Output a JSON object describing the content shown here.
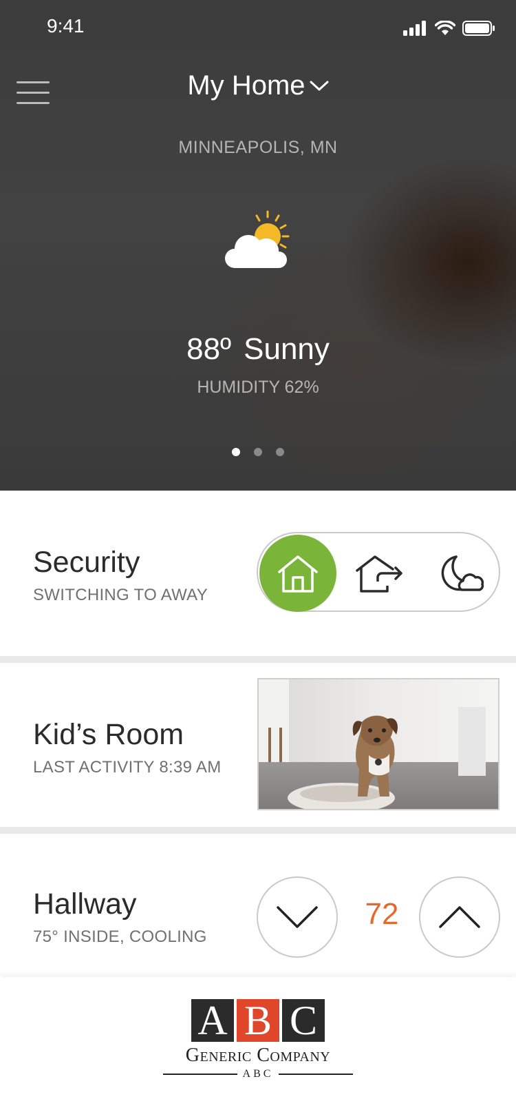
{
  "status": {
    "time": "9:41"
  },
  "header": {
    "title": "My Home",
    "location": "MINNEAPOLIS, MN"
  },
  "weather": {
    "temperature": "88º",
    "condition": "Sunny",
    "humidity": "HUMIDITY 62%",
    "icon": "partly-sunny-icon",
    "page_index": 1,
    "page_count": 3
  },
  "security": {
    "title": "Security",
    "status": "SWITCHING TO AWAY",
    "modes": [
      {
        "name": "home",
        "icon": "home-icon",
        "active": true
      },
      {
        "name": "away",
        "icon": "away-icon",
        "active": false
      },
      {
        "name": "night",
        "icon": "night-icon",
        "active": false
      }
    ],
    "accent": "#7ab53a"
  },
  "camera": {
    "title": "Kid’s Room",
    "status": "LAST ACTIVITY 8:39 AM"
  },
  "thermostat": {
    "title": "Hallway",
    "status": "75° INSIDE, COOLING",
    "setpoint": "72",
    "setpoint_color": "#e46a2c"
  },
  "logo": {
    "letters": [
      "A",
      "B",
      "C"
    ],
    "name": "Generic Company",
    "tag": "ABC"
  }
}
